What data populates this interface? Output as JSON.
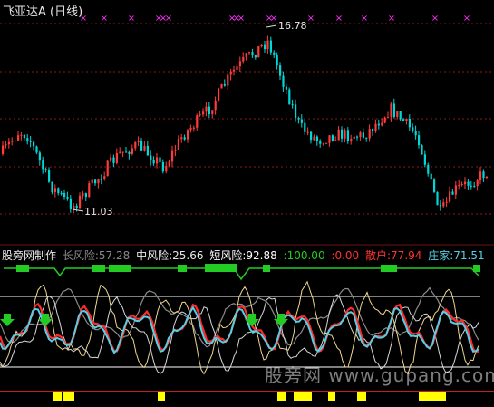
{
  "app": {
    "stock_title": "飞亚达A (日线)"
  },
  "upper_panel": {
    "high_label": "16.78",
    "low_label": "11.03",
    "x_marker": "×"
  },
  "indicator": {
    "name": "股旁网制作",
    "long_risk": "长风险:57.28",
    "mid_risk": "中风险:25.66",
    "short_risk": "短风险:92.88",
    "v100": ":100.00",
    "v0": ":0.00",
    "retail": "散户:77.94",
    "dealer": "庄家:71.51"
  },
  "watermark": "股旁网 www.gupang.com",
  "colors": {
    "background": "#000000",
    "up_candle": "#ff3b3b",
    "down_candle": "#00d8d8",
    "grid": "#8b1a1a",
    "magenta": "#ff33ff",
    "green": "#22cc22",
    "yellow": "#ffff00",
    "red_line": "#ff2a2a",
    "cyan_line": "#55cfe6",
    "gray_line": "#8c8c8c",
    "white_line": "#ffffff",
    "tan_line": "#f0d890"
  }
}
